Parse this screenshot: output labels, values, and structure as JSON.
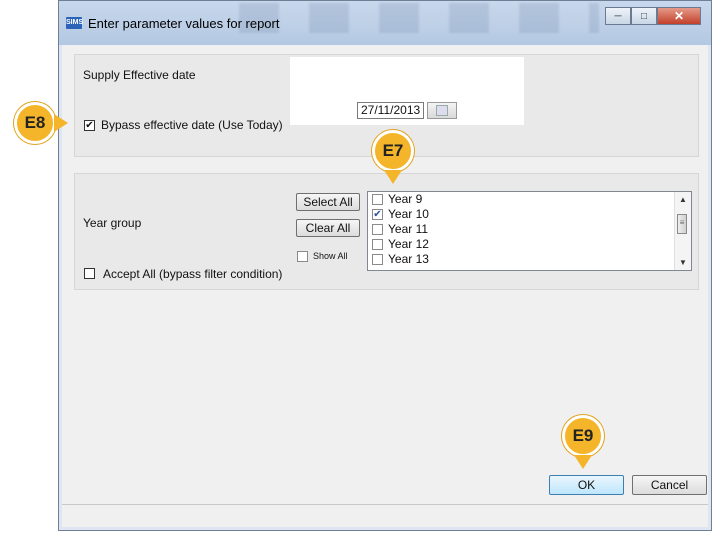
{
  "window": {
    "title": "Enter parameter values for report",
    "app_icon": "SIMS",
    "controls": [
      "minimize-icon",
      "maximize-icon",
      "close-icon"
    ]
  },
  "date_section": {
    "label": "Supply Effective date",
    "date_value": "27/11/2013",
    "calendar_icon": "calendar-icon",
    "bypass_label": "Bypass effective date (Use Today)",
    "bypass_checked": true
  },
  "year_section": {
    "label": "Year group",
    "select_all": "Select All",
    "clear_all": "Clear All",
    "show_all": "Show All",
    "accept_all_label": "Accept All (bypass filter condition)",
    "items": [
      {
        "label": "Year  9",
        "checked": false
      },
      {
        "label": "Year 10",
        "checked": true
      },
      {
        "label": "Year 11",
        "checked": false
      },
      {
        "label": "Year 12",
        "checked": false
      },
      {
        "label": "Year 13",
        "checked": false
      }
    ]
  },
  "buttons": {
    "ok": "OK",
    "cancel": "Cancel"
  },
  "annotations": {
    "e7": "E7",
    "e8": "E8",
    "e9": "E9",
    "color": "#f4b52a"
  }
}
